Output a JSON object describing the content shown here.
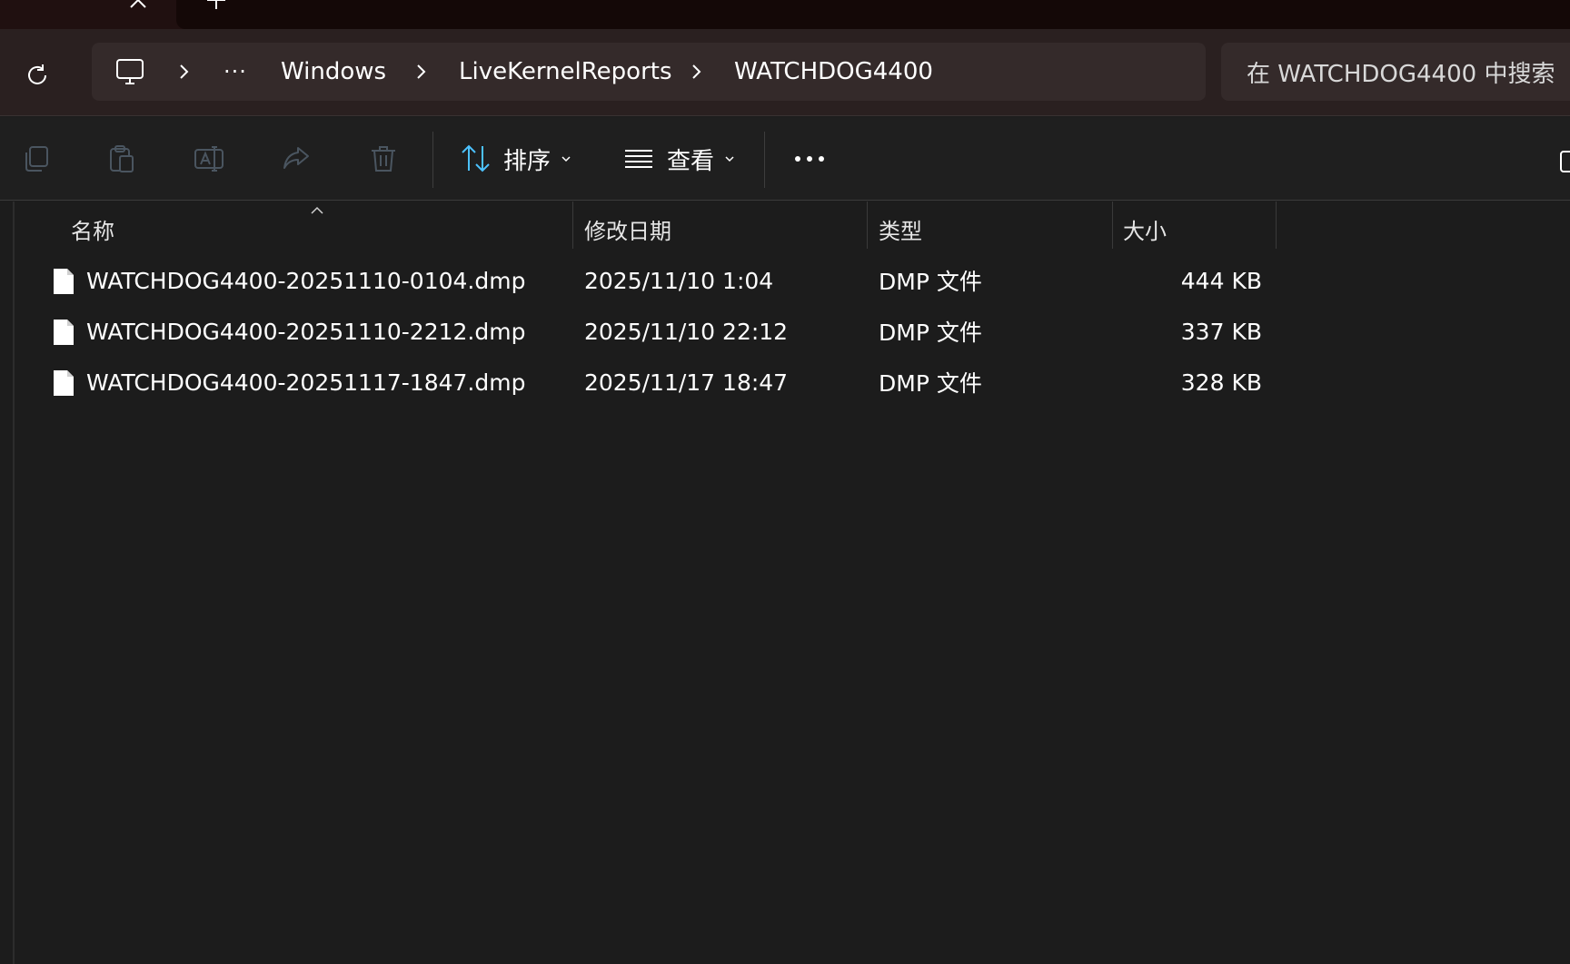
{
  "window": {
    "colors": {
      "tabstrip": "#201010",
      "address_bar": "#2a2020",
      "command_bar": "#1f1f1f",
      "content": "#1c1c1c",
      "accent": "#4cc2ff"
    }
  },
  "tabs": {
    "close_icon": "close-icon",
    "add_icon": "plus-icon"
  },
  "address": {
    "refresh_icon": "refresh-icon",
    "root_icon": "this-pc-icon",
    "overflow_label": "···",
    "crumbs": [
      {
        "label": "Windows"
      },
      {
        "label": "LiveKernelReports"
      },
      {
        "label": "WATCHDOG4400"
      }
    ],
    "search_placeholder": "在 WATCHDOG4400 中搜索"
  },
  "command_bar": {
    "icons": [
      "copy-icon",
      "paste-icon",
      "rename-icon",
      "share-icon",
      "delete-icon"
    ],
    "sort": {
      "label": "排序",
      "icon": "sort-icon"
    },
    "view": {
      "label": "查看",
      "icon": "view-list-icon"
    },
    "more_icon": "more-icon"
  },
  "file_list": {
    "columns": {
      "name": "名称",
      "modified": "修改日期",
      "type": "类型",
      "size": "大小"
    },
    "sort_direction": "ascending",
    "rows": [
      {
        "name": "WATCHDOG4400-20251110-0104.dmp",
        "modified": "2025/11/10 1:04",
        "type": "DMP 文件",
        "size": "444 KB"
      },
      {
        "name": "WATCHDOG4400-20251110-2212.dmp",
        "modified": "2025/11/10 22:12",
        "type": "DMP 文件",
        "size": "337 KB"
      },
      {
        "name": "WATCHDOG4400-20251117-1847.dmp",
        "modified": "2025/11/17 18:47",
        "type": "DMP 文件",
        "size": "328 KB"
      }
    ]
  }
}
